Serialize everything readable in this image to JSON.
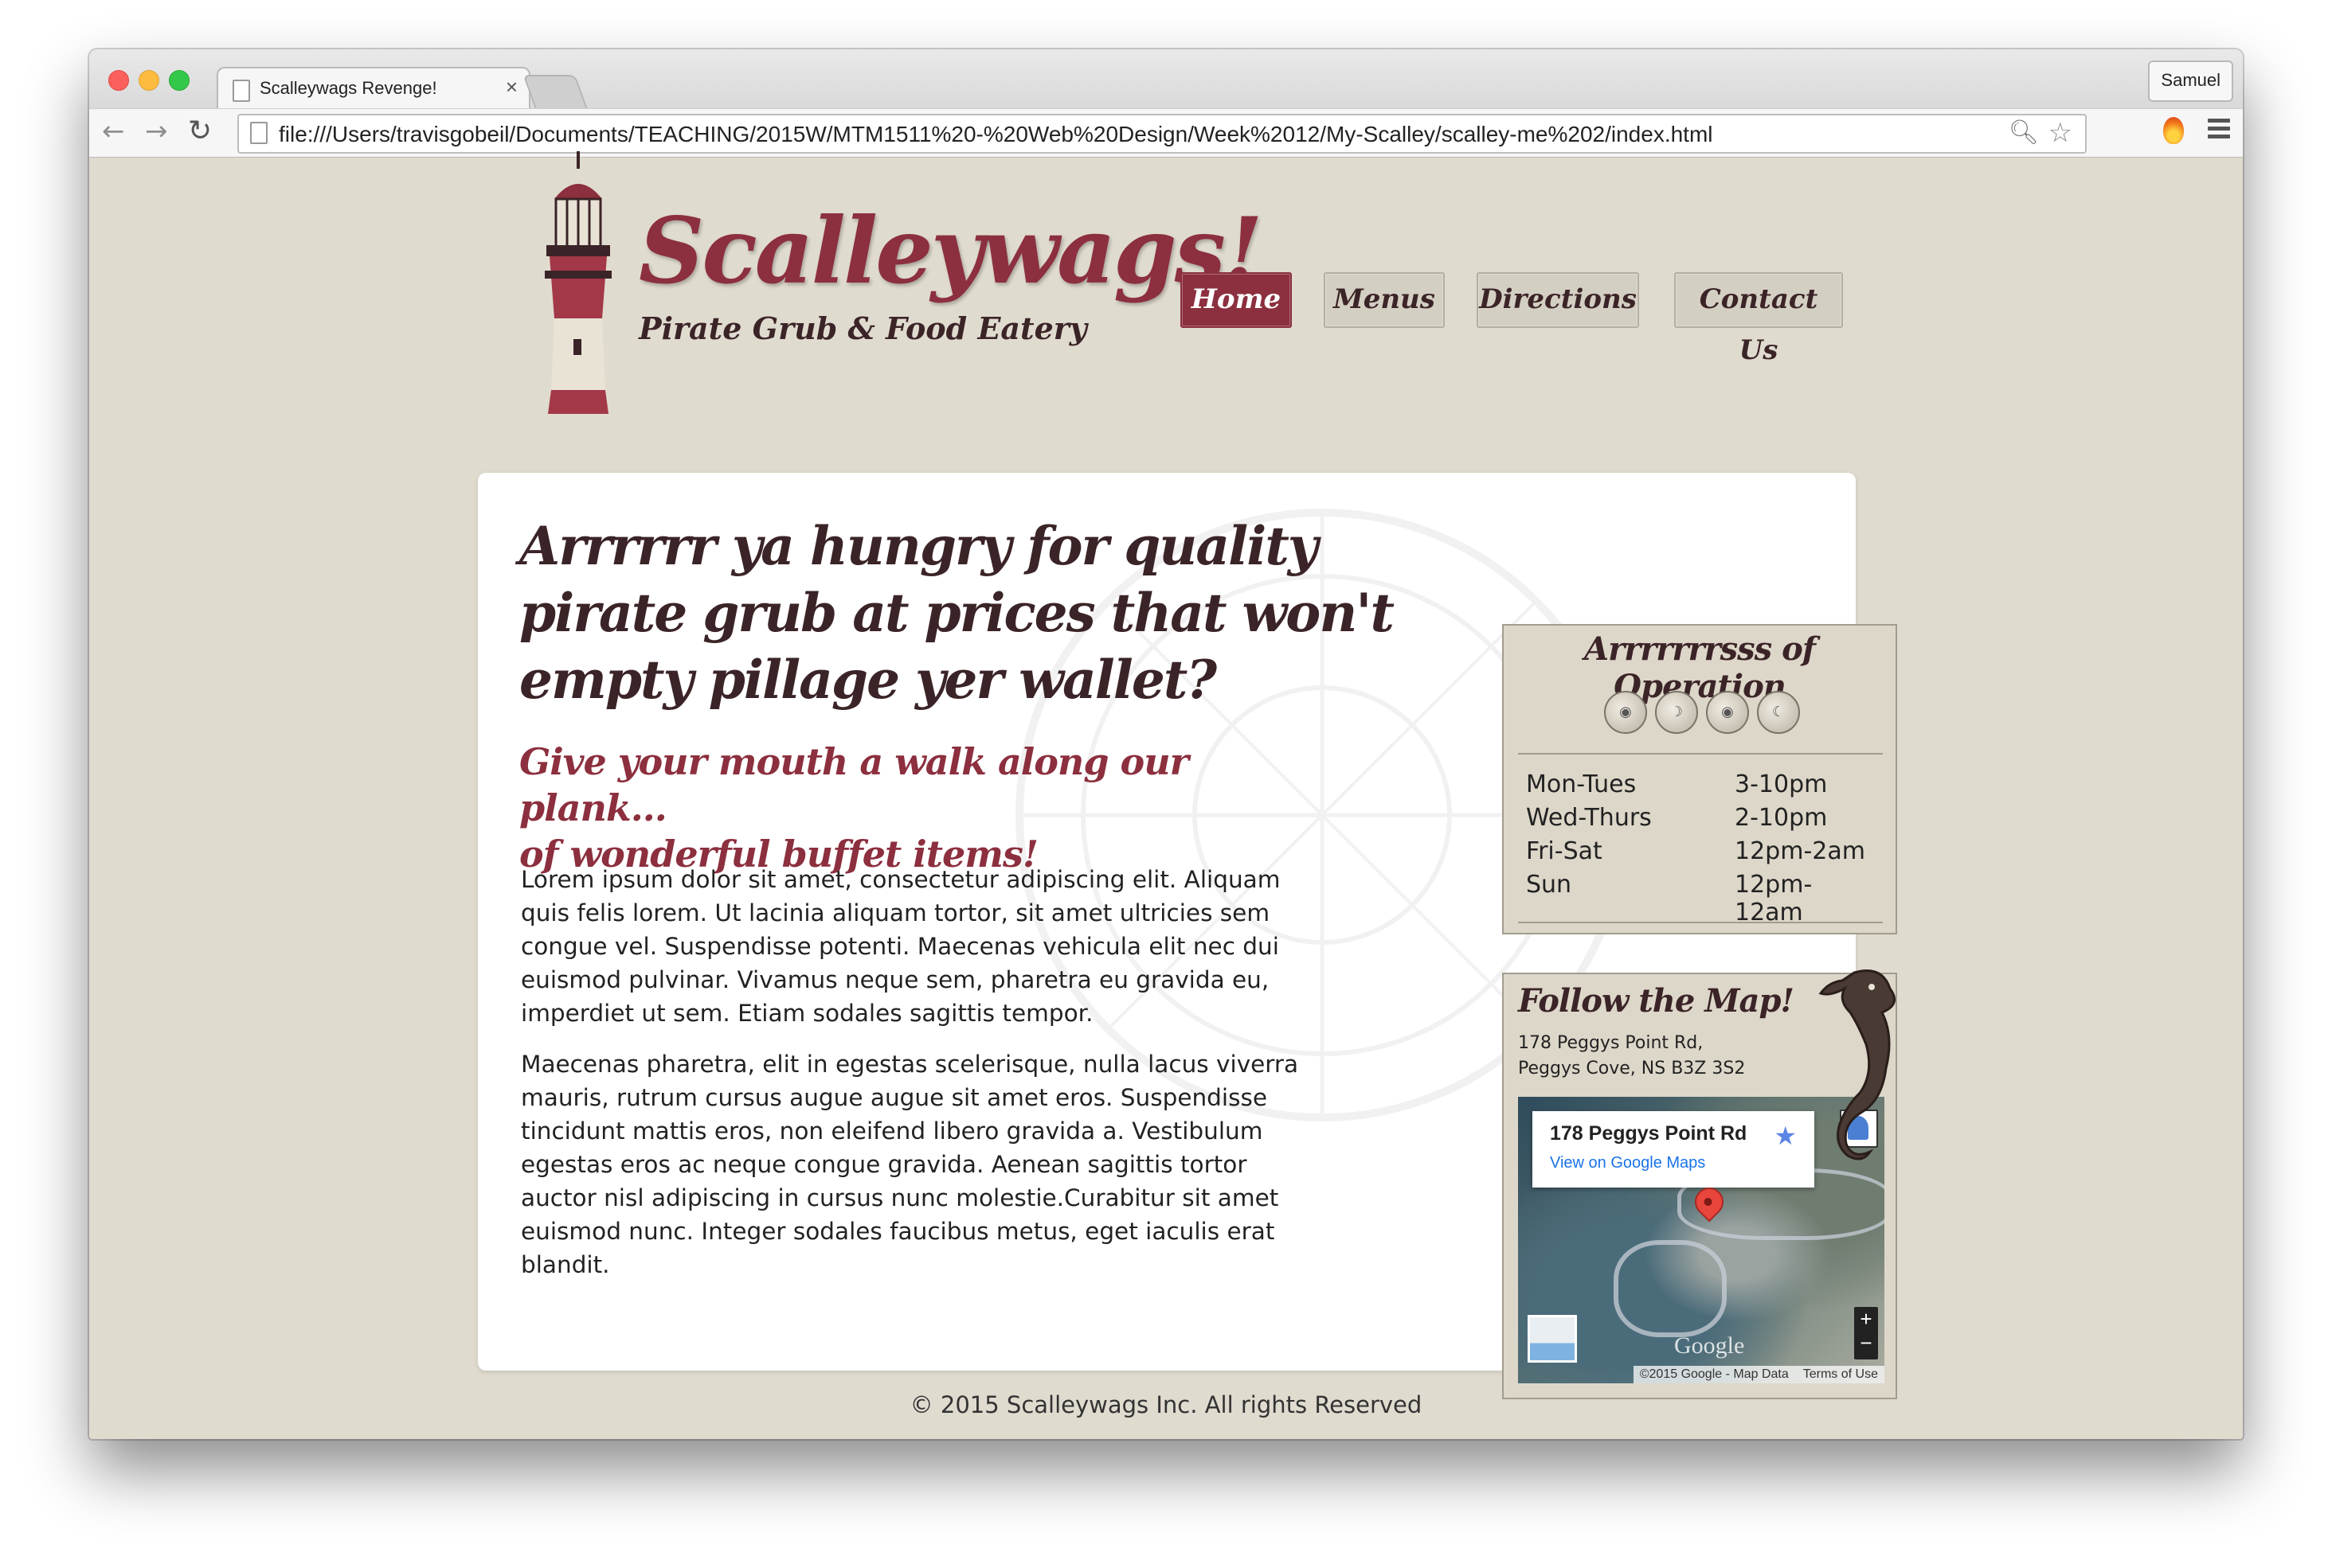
{
  "browser": {
    "tab_title": "Scalleywags Revenge!",
    "tab_close": "×",
    "profile_name": "Samuel",
    "url": "file:///Users/travisgobeil/Documents/TEACHING/2015W/MTM1511%20-%20Web%20Design/Week%2012/My-Scalley/scalley-me%202/index.html",
    "icons": [
      "back-arrow-icon",
      "forward-arrow-icon",
      "reload-icon",
      "search-icon",
      "star-icon",
      "fire-extension-icon",
      "menu-icon"
    ]
  },
  "header": {
    "brand": "Scalleywags!",
    "tagline": "Pirate Grub & Food Eatery",
    "nav": [
      {
        "label": "Home",
        "active": true
      },
      {
        "label": "Menus",
        "active": false
      },
      {
        "label": "Directions",
        "active": false
      },
      {
        "label": "Contact Us",
        "active": false
      }
    ]
  },
  "main": {
    "headline": "Arrrrrr ya hungry for quality pirate grub at prices that won't empty pillage yer wallet?",
    "subhead_line1": "Give your mouth a walk along our plank...",
    "subhead_line2": "of wonderful buffet items!",
    "paragraphs": [
      "Lorem ipsum dolor sit amet, consectetur adipiscing elit. Aliquam quis felis lorem. Ut lacinia aliquam tortor, sit amet ultricies sem congue vel. Suspendisse potenti. Maecenas vehicula elit nec dui euismod pulvinar. Vivamus neque sem, pharetra eu gravida eu, imperdiet ut sem. Etiam sodales sagittis tempor.",
      "Maecenas pharetra, elit in egestas scelerisque, nulla lacus viverra mauris, rutrum cursus augue augue sit amet eros. Suspendisse tincidunt mattis eros, non eleifend libero gravida a. Vestibulum egestas eros ac neque congue gravida. Aenean sagittis tortor auctor nisl adipiscing in cursus nunc molestie.Curabitur sit amet euismod nunc. Integer sodales faucibus metus, eget iaculis erat blandit."
    ]
  },
  "hours": {
    "title": "Arrrrrrrsss of Operation",
    "rows": [
      {
        "day": "Mon-Tues",
        "time": "3-10pm"
      },
      {
        "day": "Wed-Thurs",
        "time": "2-10pm"
      },
      {
        "day": "Fri-Sat",
        "time": "12pm-2am"
      },
      {
        "day": "Sun",
        "time": "12pm-12am"
      }
    ]
  },
  "map": {
    "title": "Follow the Map!",
    "address_line1": "178 Peggys Point Rd,",
    "address_line2": "Peggys Cove, NS B3Z 3S2",
    "info_title": "178 Peggys Point Rd",
    "info_link": "View on Google Maps",
    "zoom_in": "+",
    "zoom_out": "−",
    "google_logo": "Google",
    "attribution": "©2015 Google - Map Data",
    "terms": "Terms of Use"
  },
  "footer": {
    "copyright": "© 2015 Scalleywags Inc. All rights Reserved"
  },
  "colors": {
    "page_background": "#e0dbcf",
    "brand": "#8c2f3e",
    "dark_text": "#3b2427",
    "panel": "#ddd7c9"
  }
}
